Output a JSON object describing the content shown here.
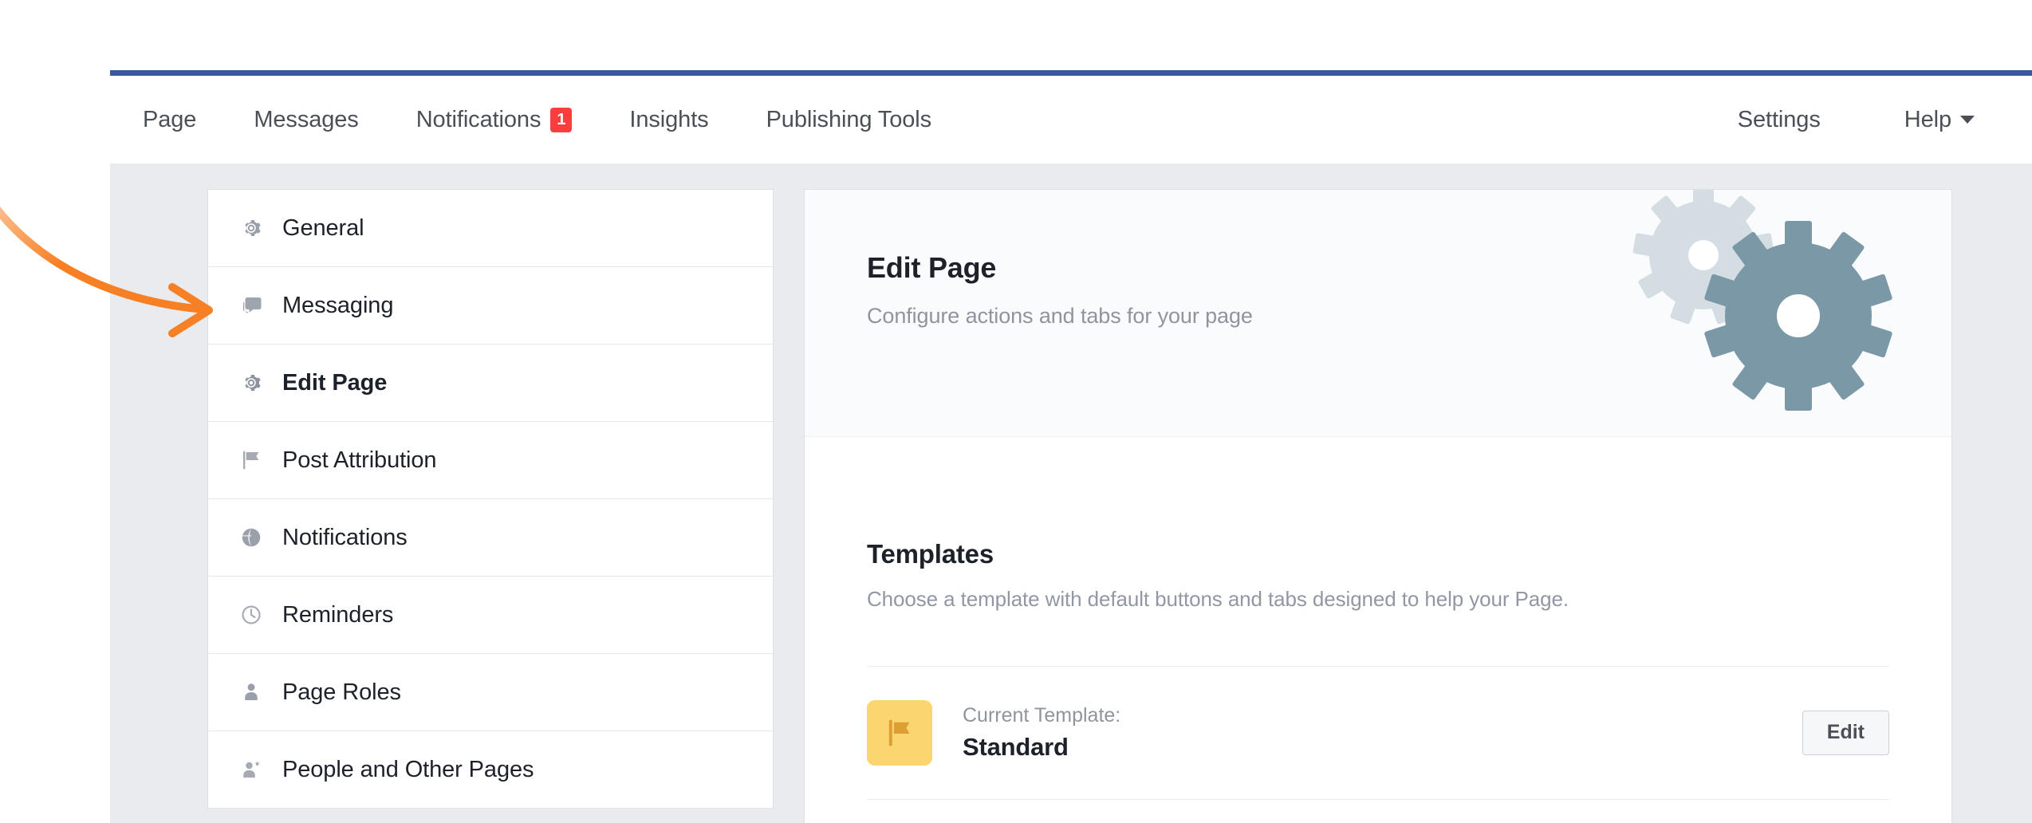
{
  "nav": {
    "left_items": [
      {
        "label": "Page",
        "badge": null
      },
      {
        "label": "Messages",
        "badge": null
      },
      {
        "label": "Notifications",
        "badge": "1"
      },
      {
        "label": "Insights",
        "badge": null
      },
      {
        "label": "Publishing Tools",
        "badge": null
      }
    ],
    "right_items": [
      {
        "label": "Settings",
        "caret": false
      },
      {
        "label": "Help",
        "caret": true
      }
    ],
    "badge_color": "#fa3e3e",
    "rule_color": "#3b5998"
  },
  "sidebar": {
    "items": [
      {
        "label": "General",
        "icon": "gear-icon",
        "active": false
      },
      {
        "label": "Messaging",
        "icon": "chat-bubble-icon",
        "active": false
      },
      {
        "label": "Edit Page",
        "icon": "gear-icon",
        "active": true
      },
      {
        "label": "Post Attribution",
        "icon": "flag-icon",
        "active": false
      },
      {
        "label": "Notifications",
        "icon": "globe-icon",
        "active": false
      },
      {
        "label": "Reminders",
        "icon": "clock-icon",
        "active": false
      },
      {
        "label": "Page Roles",
        "icon": "person-icon",
        "active": false
      },
      {
        "label": "People and Other Pages",
        "icon": "person-star-icon",
        "active": false
      }
    ]
  },
  "main": {
    "header": {
      "title": "Edit Page",
      "subtitle": "Configure actions and tabs for your page",
      "illustration": "gears-icon",
      "gear_light_color": "#d3dde2",
      "gear_dark_color": "#7b98a6"
    },
    "templates": {
      "title": "Templates",
      "subtitle": "Choose a template with default buttons and tabs designed to help your Page.",
      "current": {
        "thumb_icon": "flag-icon",
        "thumb_bg": "#fbd570",
        "thumb_fg": "#dd9f33",
        "label": "Current Template:",
        "value": "Standard",
        "action_label": "Edit"
      }
    }
  },
  "annotation": {
    "arrow": "curved-arrow-pointing-right",
    "color": "#f78024",
    "points_to": "Edit Page"
  }
}
